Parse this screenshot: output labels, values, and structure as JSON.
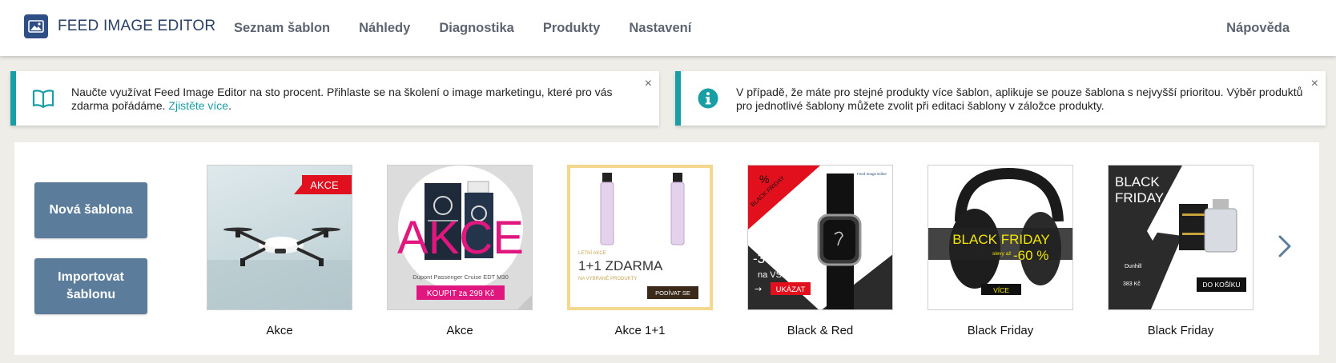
{
  "header": {
    "brand": "FEED IMAGE EDITOR",
    "nav": [
      "Seznam šablon",
      "Náhledy",
      "Diagnostika",
      "Produkty",
      "Nastavení"
    ],
    "help": "Nápověda"
  },
  "notices": [
    {
      "icon": "book-icon",
      "text": "Naučte využívat Feed Image Editor na sto procent. Přihlaste se na školení o image marketingu, které pro vás zdarma pořádáme.",
      "link": "Zjistěte více",
      "after_link": ".",
      "close": "×"
    },
    {
      "icon": "info-icon",
      "text": "V případě, že máte pro stejné produkty více šablon, aplikuje se pouze šablona s nejvyšší prioritou. Výběr produktů pro jednotlivé šablony můžete zvolit při editaci šablony v záložce produkty.",
      "close": "×"
    }
  ],
  "actions": {
    "new_template": "Nová šablona",
    "import_template": "Importovat šablonu"
  },
  "templates": [
    {
      "name": "Akce",
      "badge": "AKCE"
    },
    {
      "name": "Akce",
      "headline": "AKCE",
      "product": "Dupont Passenger Cruise EDT M30",
      "cta": "KOUPIT za 299 Kč"
    },
    {
      "name": "Akce 1+1",
      "kicker": "LETNÍ AKCE",
      "headline": "1+1 ZDARMA",
      "sub": "NA VYBRANÉ PRODUKTY",
      "cta": "PODÍVAT SE"
    },
    {
      "name": "Black & Red",
      "corner": "BLACK FRIDAY",
      "percent": "%",
      "discount": "-30 %",
      "discount_sub": "na VŠE",
      "cta": "UKÁZAT",
      "brand_tag": "Feed Image Editor"
    },
    {
      "name": "Black Friday",
      "headline": "BLACK FRIDAY",
      "sub": "slevy až",
      "discount": "-60 %",
      "cta": "VÍCE"
    },
    {
      "name": "Black Friday",
      "headline": "BLACK FRIDAY",
      "product": "Dunhill",
      "price": "383 Kč",
      "cta": "DO KOŠÍKU"
    }
  ],
  "colors": {
    "accent": "#1a9ea6",
    "button": "#5b7d9b",
    "brand": "#2e4f85"
  }
}
